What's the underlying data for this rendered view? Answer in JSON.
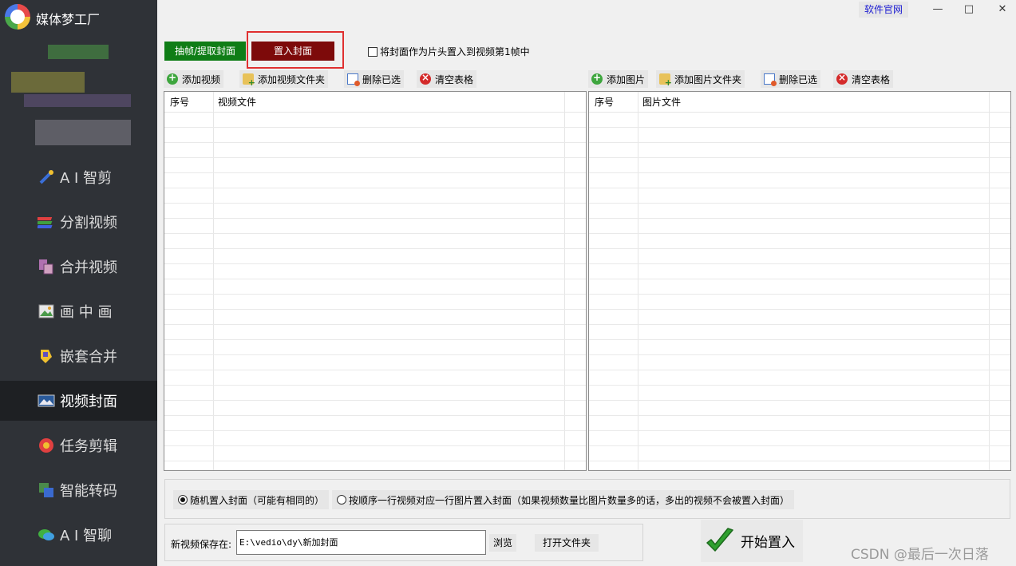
{
  "app": {
    "title": "媒体梦工厂"
  },
  "topbar": {
    "site_link": "软件官网",
    "minimize": "—",
    "maximize": "□",
    "close": "✕"
  },
  "sidebar": {
    "items": [
      {
        "label": "A I 智剪",
        "icon": "ai-cut-icon",
        "active": false
      },
      {
        "label": "分割视频",
        "icon": "split-video-icon",
        "active": false
      },
      {
        "label": "合并视频",
        "icon": "merge-video-icon",
        "active": false
      },
      {
        "label": "画 中 画",
        "icon": "picture-in-picture-icon",
        "active": false
      },
      {
        "label": "嵌套合并",
        "icon": "nested-merge-icon",
        "active": false
      },
      {
        "label": "视频封面",
        "icon": "video-cover-icon",
        "active": true
      },
      {
        "label": "任务剪辑",
        "icon": "task-edit-icon",
        "active": false
      },
      {
        "label": "智能转码",
        "icon": "transcode-icon",
        "active": false
      },
      {
        "label": "A I 智聊",
        "icon": "ai-chat-icon",
        "active": false
      }
    ]
  },
  "tabs": {
    "extract": "抽帧/提取封面",
    "embed": "置入封面"
  },
  "options": {
    "cover_first_frame": "将封面作为片头置入到视频第1帧中"
  },
  "video_toolbar": {
    "add": "添加视频",
    "add_folder": "添加视频文件夹",
    "delete_selected": "删除已选",
    "clear": "清空表格"
  },
  "image_toolbar": {
    "add": "添加图片",
    "add_folder": "添加图片文件夹",
    "delete_selected": "删除已选",
    "clear": "清空表格"
  },
  "video_table": {
    "columns": [
      "序号",
      "视频文件"
    ]
  },
  "image_table": {
    "columns": [
      "序号",
      "图片文件"
    ]
  },
  "modes": {
    "random": "随机置入封面（可能有相同的）",
    "sequential": "按顺序一行视频对应一行图片置入封面（如果视频数量比图片数量多的话，多出的视频不会被置入封面）",
    "selected": "random"
  },
  "save": {
    "label": "新视频保存在:",
    "path": "E:\\vedio\\dy\\新加封面",
    "browse": "浏览",
    "open_folder": "打开文件夹"
  },
  "start_button": "开始置入",
  "watermark": "CSDN @最后一次日落",
  "colors": {
    "sidebar": "#2f3237",
    "extract_tab": "#0f7d16",
    "embed_tab": "#7d0a0a",
    "highlight": "#e03030"
  }
}
